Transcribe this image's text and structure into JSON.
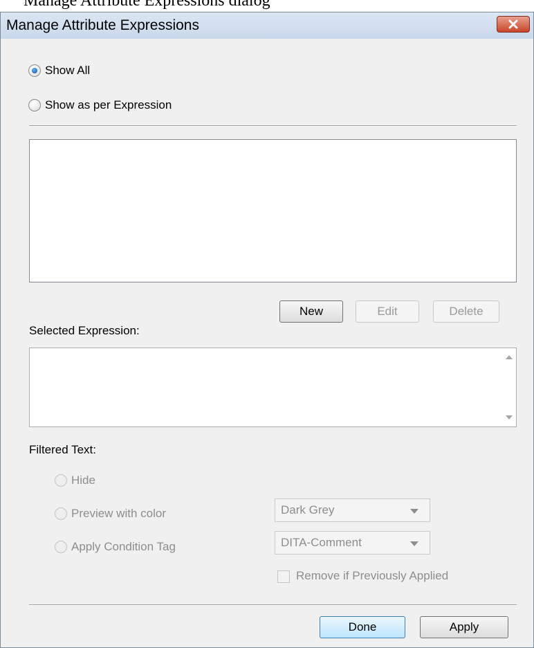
{
  "document": {
    "caption": "Manage Attribute Expressions dialog"
  },
  "dialog": {
    "title": "Manage Attribute Expressions",
    "close_icon": "close-icon"
  },
  "mode": {
    "options": [
      {
        "label": "Show All",
        "checked": true
      },
      {
        "label": "Show as per Expression",
        "checked": false
      }
    ]
  },
  "expressions": {
    "items": [],
    "buttons": {
      "new": "New",
      "edit": "Edit",
      "delete": "Delete"
    },
    "selected_label": "Selected Expression:",
    "selected_value": ""
  },
  "filtered_text": {
    "label": "Filtered Text:",
    "options": [
      {
        "label": "Hide",
        "enabled": false
      },
      {
        "label": "Preview with color",
        "enabled": false
      },
      {
        "label": "Apply Condition Tag",
        "enabled": false
      }
    ],
    "color_select": "Dark Grey",
    "tag_select": "DITA-Comment",
    "remove_checkbox": {
      "label": "Remove if Previously Applied",
      "checked": false
    }
  },
  "footer": {
    "done": "Done",
    "apply": "Apply"
  },
  "colors": {
    "title_bar": "#c9d8ea",
    "close_button": "#c9452a",
    "default_button": "#bee6fd"
  }
}
